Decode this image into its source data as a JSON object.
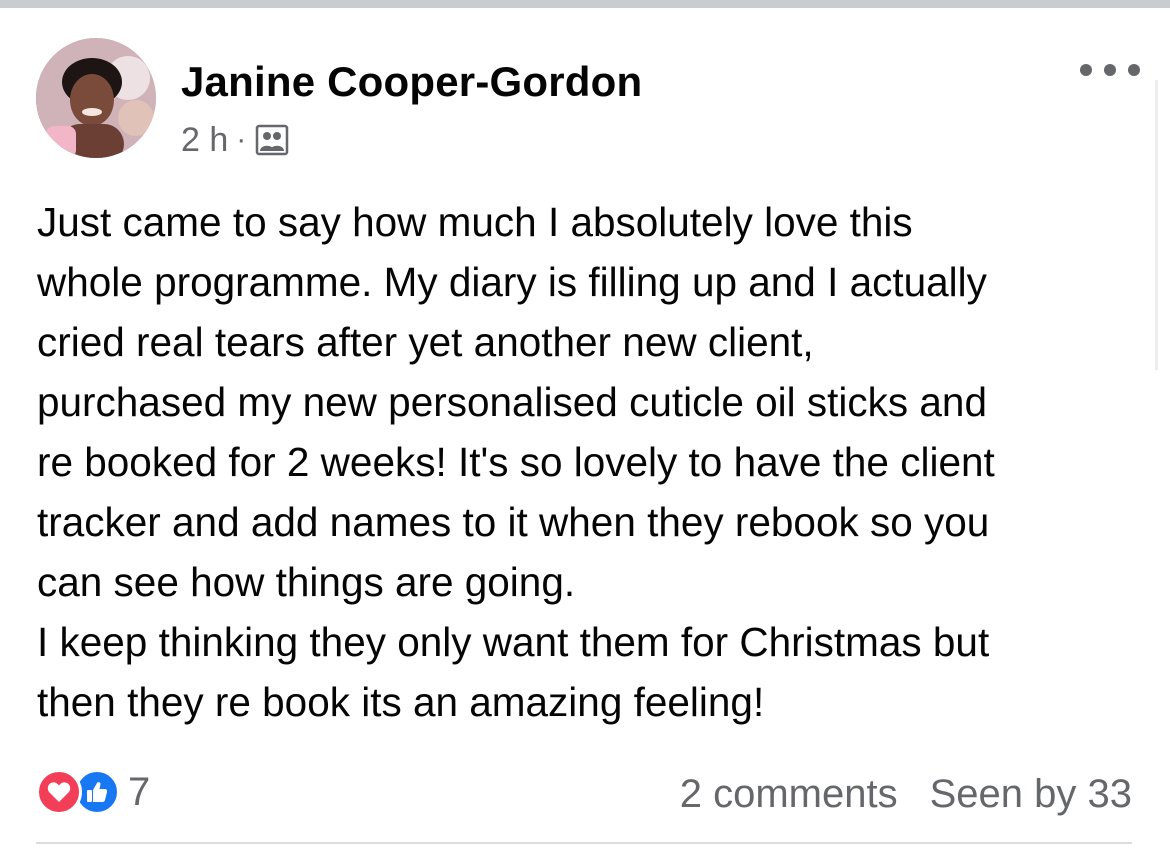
{
  "post": {
    "author": "Janine Cooper-Gordon",
    "time": "2 h",
    "separator": "·",
    "audience_icon": "group-audience-icon",
    "more_icon": "more-options-icon",
    "text_lines": [
      "Just came to say how much I absolutely love this",
      "whole programme. My diary is filling up and I actually",
      "cried real tears after yet another new client,",
      "purchased my new personalised cuticle oil sticks and",
      "re booked for 2 weeks! It's so lovely to have the client",
      "tracker and add names to it when they rebook so you",
      "can see how things are going.",
      "I keep thinking they only want them for Christmas but",
      "then they re book its an amazing feeling!"
    ],
    "reactions": {
      "icons": [
        "love-icon",
        "like-icon"
      ],
      "count": "7"
    },
    "comments": "2 comments",
    "seen_by": "Seen by 33"
  },
  "colors": {
    "love": "#f33e58",
    "like": "#1877f2",
    "secondary_text": "#65676b",
    "primary_text": "#050505"
  }
}
